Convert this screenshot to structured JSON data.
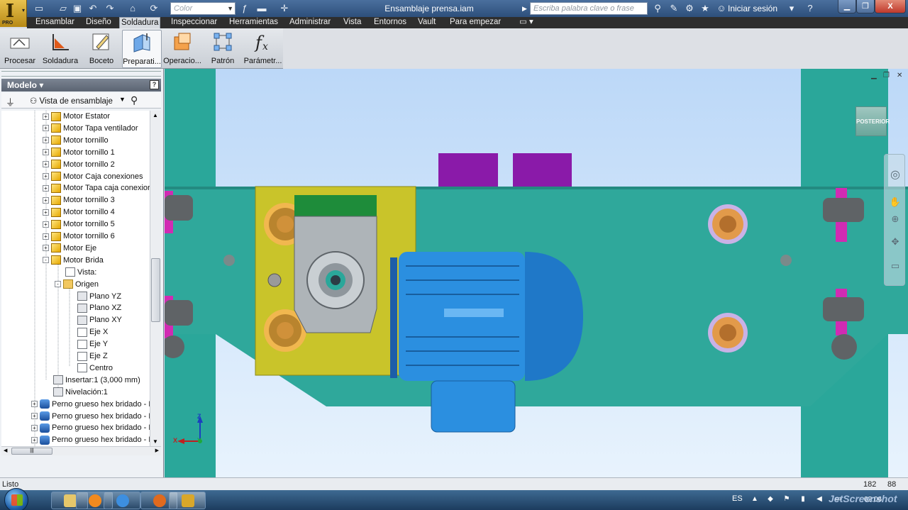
{
  "app": {
    "logo_letter": "I",
    "logo_edition": "PRO",
    "document_title": "Ensamblaje prensa.iam",
    "color_placeholder": "Color",
    "help_search_placeholder": "Escriba palabra clave o frase",
    "signin_label": "Iniciar sesión",
    "help_icon_label": "?",
    "close_label": "X"
  },
  "menu_tabs": [
    {
      "label": "Ensamblar"
    },
    {
      "label": "Diseño"
    },
    {
      "label": "Soldadura"
    },
    {
      "label": "Inspeccionar"
    },
    {
      "label": "Herramientas"
    },
    {
      "label": "Administrar"
    },
    {
      "label": "Vista"
    },
    {
      "label": "Entornos"
    },
    {
      "label": "Vault"
    },
    {
      "label": "Para empezar"
    }
  ],
  "active_tab": "Soldadura",
  "ribbon": [
    {
      "label": "Procesar",
      "icon": "process-icon"
    },
    {
      "label": "Soldadura",
      "icon": "weld-icon"
    },
    {
      "label": "Boceto",
      "icon": "sketch-icon"
    },
    {
      "label": "Preparati...",
      "icon": "preparation-icon"
    },
    {
      "label": "Operacio...",
      "icon": "machining-icon"
    },
    {
      "label": "Patrón",
      "icon": "pattern-icon"
    },
    {
      "label": "Parámetr...",
      "icon": "parameters-icon"
    }
  ],
  "panel": {
    "title": "Modelo",
    "help": "?",
    "view_label": "Vista de ensamblaje"
  },
  "tree": [
    {
      "label": "Motor Estator",
      "indent": 1,
      "icon": "part",
      "exp": "+"
    },
    {
      "label": "Motor Tapa ventilador",
      "indent": 1,
      "icon": "part",
      "exp": "+"
    },
    {
      "label": "Motor tornillo",
      "indent": 1,
      "icon": "part",
      "exp": "+"
    },
    {
      "label": "Motor tornillo 1",
      "indent": 1,
      "icon": "part",
      "exp": "+"
    },
    {
      "label": "Motor tornillo 2",
      "indent": 1,
      "icon": "part",
      "exp": "+"
    },
    {
      "label": "Motor Caja conexiones",
      "indent": 1,
      "icon": "part",
      "exp": "+"
    },
    {
      "label": "Motor Tapa caja conexior",
      "indent": 1,
      "icon": "part",
      "exp": "+"
    },
    {
      "label": "Motor tornillo 3",
      "indent": 1,
      "icon": "part",
      "exp": "+"
    },
    {
      "label": "Motor tornillo 4",
      "indent": 1,
      "icon": "part",
      "exp": "+"
    },
    {
      "label": "Motor tornillo 5",
      "indent": 1,
      "icon": "part",
      "exp": "+"
    },
    {
      "label": "Motor tornillo 6",
      "indent": 1,
      "icon": "part",
      "exp": "+"
    },
    {
      "label": "Motor Eje",
      "indent": 1,
      "icon": "part",
      "exp": "+"
    },
    {
      "label": "Motor Brida",
      "indent": 1,
      "icon": "part",
      "exp": "-"
    },
    {
      "label": "Vista:",
      "indent": 2,
      "icon": "view",
      "exp": ""
    },
    {
      "label": "Origen",
      "indent": 2,
      "icon": "folder",
      "exp": "-"
    },
    {
      "label": "Plano YZ",
      "indent": 3,
      "icon": "plane",
      "exp": ""
    },
    {
      "label": "Plano XZ",
      "indent": 3,
      "icon": "plane",
      "exp": ""
    },
    {
      "label": "Plano XY",
      "indent": 3,
      "icon": "plane",
      "exp": ""
    },
    {
      "label": "Eje X",
      "indent": 3,
      "icon": "axis",
      "exp": ""
    },
    {
      "label": "Eje Y",
      "indent": 3,
      "icon": "axis",
      "exp": ""
    },
    {
      "label": "Eje Z",
      "indent": 3,
      "icon": "axis",
      "exp": ""
    },
    {
      "label": "Centro",
      "indent": 3,
      "icon": "point",
      "exp": ""
    },
    {
      "label": "Insertar:1 (3,000 mm)",
      "indent": 1,
      "icon": "constraint",
      "exp": ""
    },
    {
      "label": "Nivelación:1",
      "indent": 1,
      "icon": "constraint",
      "exp": ""
    },
    {
      "label": "Perno grueso hex bridado - M",
      "indent": 0,
      "icon": "bolt",
      "exp": "+"
    },
    {
      "label": "Perno grueso hex bridado - M",
      "indent": 0,
      "icon": "bolt",
      "exp": "+"
    },
    {
      "label": "Perno grueso hex bridado - M",
      "indent": 0,
      "icon": "bolt",
      "exp": "+"
    },
    {
      "label": "Perno grueso hex bridado - M",
      "indent": 0,
      "icon": "bolt",
      "exp": "+"
    }
  ],
  "viewport": {
    "viewcube_face": "POSTERIOR",
    "axis_z": "Z",
    "axis_x": "X",
    "axis_y": "Y"
  },
  "status": {
    "text": "Listo",
    "value1": "182",
    "value2": "88"
  },
  "taskbar": {
    "language": "ES",
    "clock": "02:06"
  },
  "watermark": "JetScreenshot",
  "colors": {
    "frame_teal": "#2aa79a",
    "gearbox_yellow": "#c9c42a",
    "motor_blue": "#2b8fe0",
    "purple_block": "#8a1aa9",
    "magenta_pin": "#d12bb3"
  }
}
